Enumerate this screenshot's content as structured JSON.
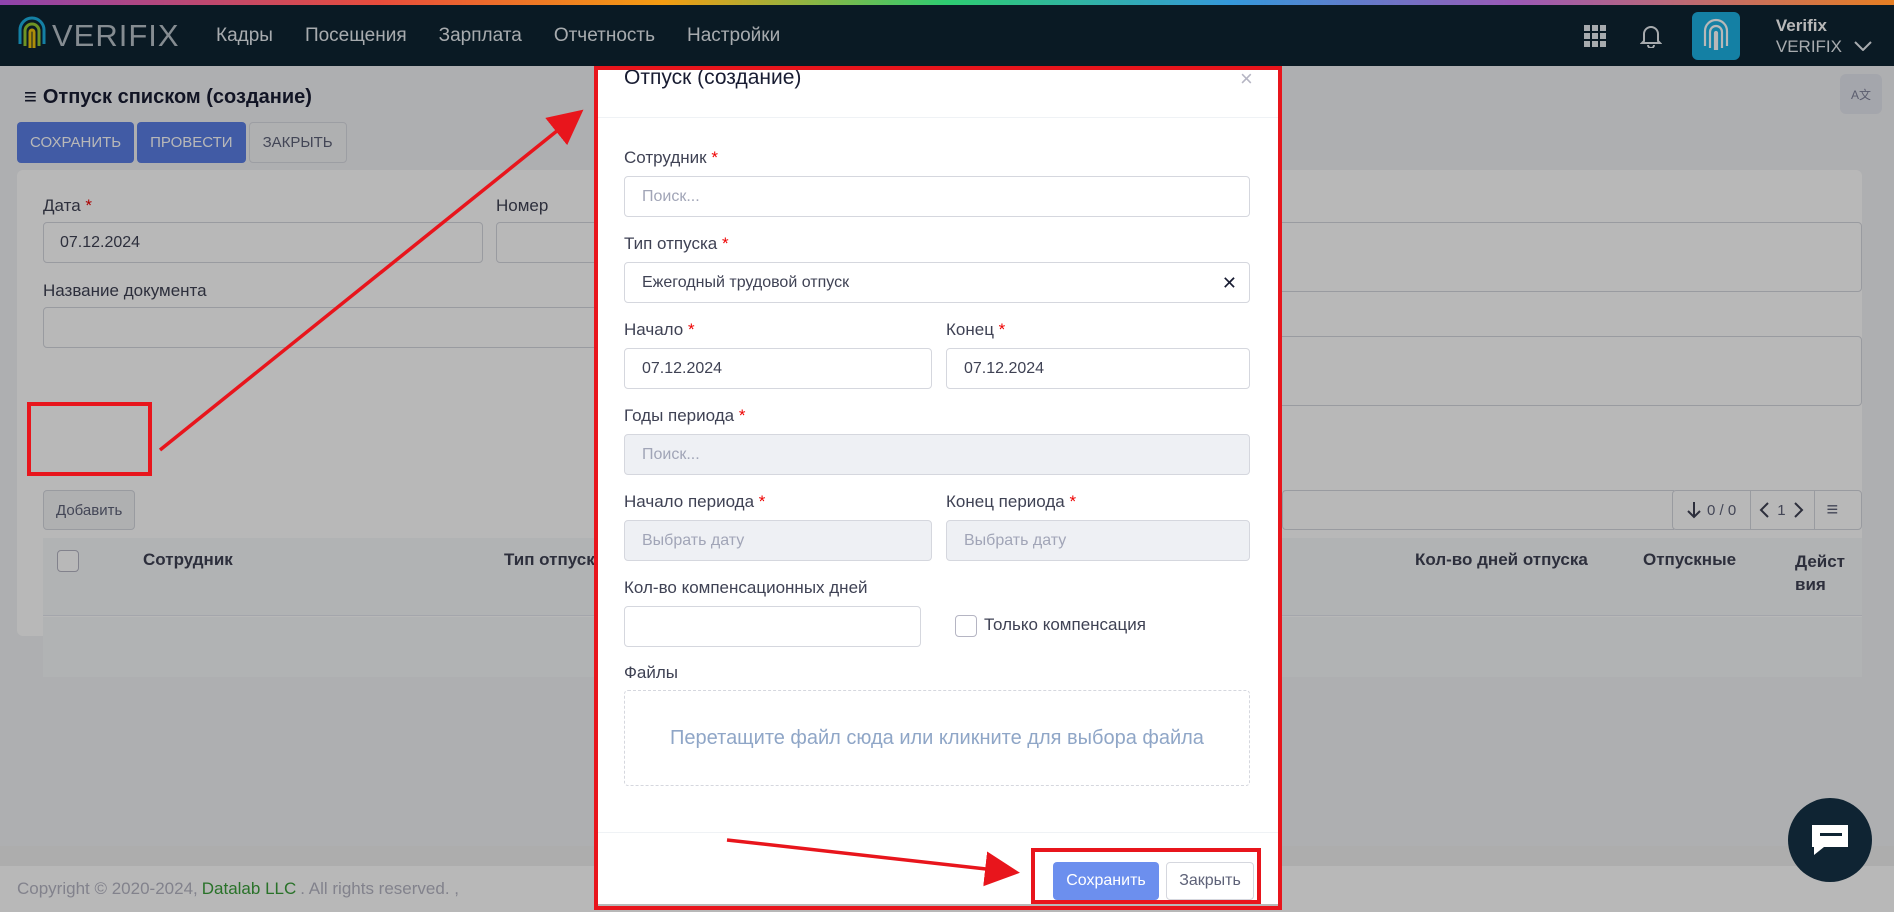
{
  "brand": {
    "name": "VERIFIX",
    "accent": "#1cb2e4",
    "nav_bg": "#0f2433"
  },
  "nav": {
    "items": [
      "Кадры",
      "Посещения",
      "Зарплата",
      "Отчетность",
      "Настройки"
    ]
  },
  "icons": {
    "apps": "grid-icon",
    "notifications": "bell-icon",
    "avatar": "fingerprint-icon",
    "user_menu": "chevron-down-icon",
    "chat": "chat-icon"
  },
  "user": {
    "name": "Verifix",
    "org": "VERIFIX"
  },
  "page": {
    "title": "Отпуск списком (создание)",
    "toolbar": {
      "save": "СОХРАНИТЬ",
      "post": "ПРОВЕСТИ",
      "close": "ЗАКРЫТЬ"
    },
    "form": {
      "date_label": "Дата",
      "date_value": "07.12.2024",
      "number_label": "Номер",
      "doc_name_label": "Название документа",
      "required_mark": "*"
    },
    "add_button": "Добавить",
    "pager": {
      "count": "0 / 0",
      "page": "1"
    },
    "grid": {
      "columns": [
        "Сотрудник",
        "Тип отпуск",
        "Кол-во дней отпуска",
        "Отпускные",
        "Дейст вия"
      ]
    }
  },
  "footer": {
    "copyright": "Copyright © 2020-2024,",
    "company": "Datalab LLC",
    "rights": ". All rights reserved. ,"
  },
  "modal": {
    "title": "Отпуск (создание)",
    "close_symbol": "×",
    "employee_label": "Сотрудник",
    "employee_placeholder": "Поиск...",
    "vacation_type_label": "Тип отпуска",
    "vacation_type_value": "Ежегодный трудовой отпуск",
    "start_label": "Начало",
    "start_value": "07.12.2024",
    "end_label": "Конец",
    "end_value": "07.12.2024",
    "period_years_label": "Годы периода",
    "period_years_placeholder": "Поиск...",
    "period_start_label": "Начало периода",
    "period_start_placeholder": "Выбрать дату",
    "period_end_label": "Конец периода",
    "period_end_placeholder": "Выбрать дату",
    "comp_days_label": "Кол-во компенсационных дней",
    "comp_days_value": "",
    "only_comp_label": "Только компенсация",
    "files_label": "Файлы",
    "dropzone_text": "Перетащите файл сюда или кликните для выбора файла",
    "save_button": "Сохранить",
    "close_button": "Закрыть",
    "required_mark": "*"
  },
  "annotation_color": "#e8151c"
}
